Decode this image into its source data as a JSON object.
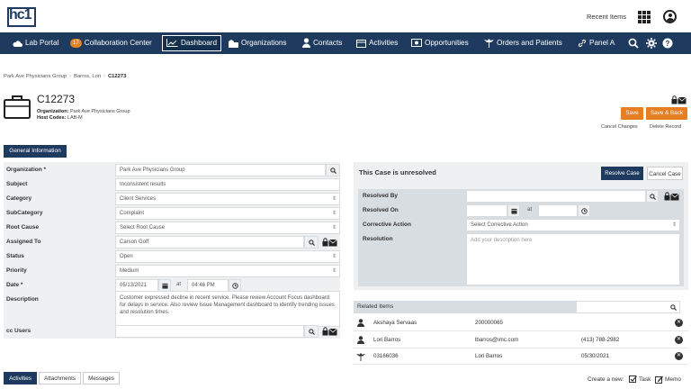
{
  "header": {
    "logo_text": "hc1",
    "recent_items": "Recent Items"
  },
  "nav": {
    "lab_portal": "Lab Portal",
    "collab_badge": "17",
    "collaboration_center": "Collaboration Center",
    "dashboard": "Dashboard",
    "organizations": "Organizations",
    "contacts": "Contacts",
    "activities": "Activities",
    "opportunities": "Opportunities",
    "orders_and_patients": "Orders and Patients",
    "panel": "Panel A"
  },
  "breadcrumb": [
    "Park Ave Physicians Group",
    "Barros, Lori",
    "C12273"
  ],
  "case": {
    "title": "C12273",
    "org_label": "Organization:",
    "org_value": "Park Ave Physicians Group",
    "host_label": "Host Codes:",
    "host_value": "LAB-M"
  },
  "actions": {
    "save": "Save",
    "save_back": "Save & Back",
    "cancel_changes": "Cancel Changes",
    "delete_record": "Delete Record"
  },
  "general_tab": "General Information",
  "form": {
    "organization": {
      "label": "Organization *",
      "value": "Park Ave Physicians Group"
    },
    "subject": {
      "label": "Subject",
      "value": "Inconsistent results"
    },
    "category": {
      "label": "Category",
      "value": "Client Services"
    },
    "subcategory": {
      "label": "SubCategory",
      "value": "Complaint"
    },
    "root_cause": {
      "label": "Root Cause",
      "value": "Select Root Cause"
    },
    "assigned_to": {
      "label": "Assigned To",
      "value": "Carson Goff"
    },
    "status": {
      "label": "Status",
      "value": "Open"
    },
    "priority": {
      "label": "Priority",
      "value": "Medium"
    },
    "date": {
      "label": "Date *",
      "value": "05/13/2021",
      "at": "at",
      "time": "04:46 PM"
    },
    "description": {
      "label": "Description",
      "value": "Customer expressed decline in recent service. Please review Account Focus dashboard for delays in service. Also review Issue Management dashboard to identify trending issues and resolution times."
    },
    "cc_users": {
      "label": "cc Users",
      "value": ""
    }
  },
  "resolution": {
    "title": "This Case is unresolved",
    "resolve_button": "Resolve Case",
    "cancel_button": "Cancel Case",
    "resolved_by": "Resolved By",
    "resolved_on": "Resolved On",
    "at": "at",
    "corrective_action": "Corrective Action",
    "corrective_action_value": "Select Corrective Action",
    "resolution": "Resolution",
    "resolution_placeholder": "Add your description here"
  },
  "related": {
    "title": "Related Items",
    "rows": [
      {
        "name": "Akshaya Servaas",
        "col2": "200000065",
        "col3": ""
      },
      {
        "name": "Lori Barros",
        "col2": "lbarros@imc.com",
        "col3": "(413) 788-2982"
      },
      {
        "name": "03166036",
        "col2": "Lori Barros",
        "col3": "05/30/2021"
      }
    ]
  },
  "bottom_tabs": [
    "Activities",
    "Attachments",
    "Messages"
  ],
  "create_new": {
    "label": "Create a new:",
    "task": "Task",
    "memo": "Memo"
  },
  "colors": {
    "navy": "#1e3a5f",
    "orange": "#e67e22",
    "panel": "#eef0f2"
  }
}
